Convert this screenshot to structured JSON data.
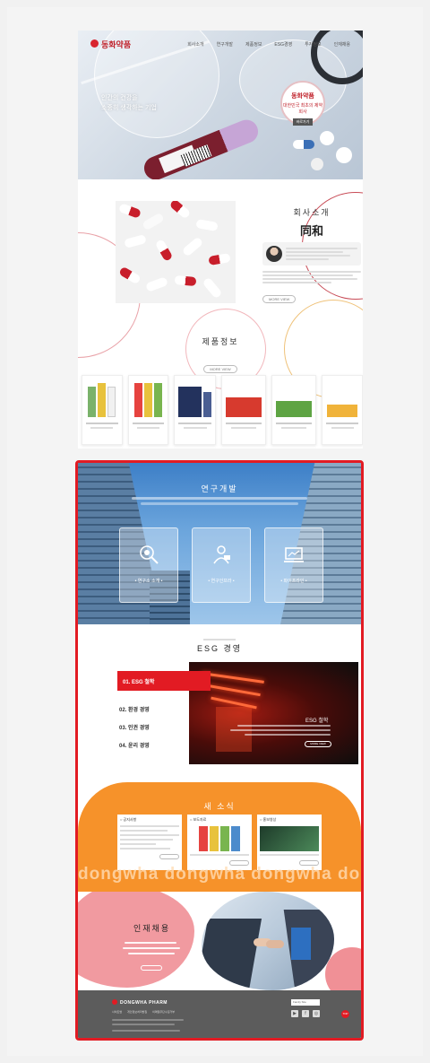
{
  "header": {
    "logo_text": "동화약품",
    "nav": [
      "회사소개",
      "연구개발",
      "제품정보",
      "ESG경영",
      "투자정보",
      "인재채용"
    ]
  },
  "hero": {
    "headline_line1": "인간의 건강을",
    "headline_line2": "소중히 생각하는 기업"
  },
  "seal": {
    "brand": "동화약품",
    "caption": "대한민국 최초의 제약회사",
    "button": "바로가기"
  },
  "about": {
    "title": "회사소개",
    "hanja": "同和",
    "more": "MORE VIEW"
  },
  "products": {
    "title": "제품정보",
    "more": "MORE VIEW"
  },
  "research": {
    "title": "연구개발",
    "cards": [
      {
        "icon": "microscope-icon",
        "label": "• 연구소 소개 •"
      },
      {
        "icon": "researcher-icon",
        "label": "• 연구인프라 •"
      },
      {
        "icon": "laptop-icon",
        "label": "• 파이프라인 •"
      }
    ]
  },
  "esg": {
    "title": "ESG 경영",
    "tabs": [
      "01. ESG 철학",
      "02. 환경 경영",
      "03. 인권 경영",
      "04. 윤리 경영"
    ],
    "photo_title": "ESG 철학",
    "more": "MORE VIEW"
  },
  "news": {
    "title": "새 소식",
    "cards": [
      {
        "heading": "○ 공지사항"
      },
      {
        "heading": "○ 보도자료"
      },
      {
        "heading": "○ 홍보영상"
      }
    ],
    "marquee": "dongwha dongwha dongwha dongwha"
  },
  "recruit": {
    "title": "인재채용"
  },
  "footer": {
    "logo": "DONGWHA PHARM",
    "links": [
      "사이트맵",
      "개인정보처리방침",
      "이메일무단수집거부"
    ],
    "family_site": "Family Site",
    "social": [
      "▶",
      "f",
      "◎"
    ],
    "top": "TOP"
  },
  "colors": {
    "brand_red": "#e21b23",
    "accent_orange": "#f6922a",
    "accent_pink": "#f19aa0",
    "footer_gray": "#5c5c5c"
  }
}
